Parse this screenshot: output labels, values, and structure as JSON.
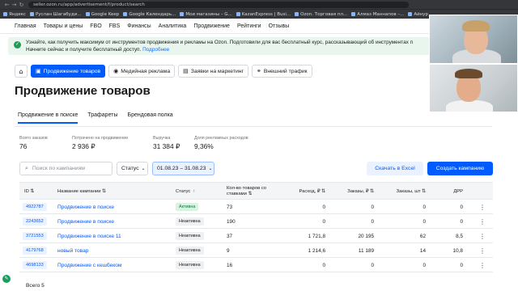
{
  "browser": {
    "url": "seller.ozon.ru/app/advertisement/f/product/search",
    "bookmarks": [
      "Яндекс",
      "Руслан Шагабуди...",
      "Google Keep",
      "Google Календарь...",
      "Мои магазины – G...",
      "KazanExpress | Busi...",
      "Ozon. Торговая пл...",
      "Алмаз Маннапов –...",
      "Айнур"
    ]
  },
  "nav": [
    "Главная",
    "Товары и цены",
    "FBO",
    "FBS",
    "Финансы",
    "Аналитика",
    "Продвижение",
    "Рейтинги",
    "Отзывы"
  ],
  "banner": {
    "text": "Узнайте, как получить максимум от инструментов продвижения и рекламы на Ozon. Подготовили для вас бесплатный курс, рассказывающий об инструментах п",
    "text2": "Начните сейчас и получите бесплатный доступ.",
    "link": "Подробнее"
  },
  "tools": [
    {
      "label": "Продвижение товаров",
      "icon": "megaphone-icon",
      "active": true
    },
    {
      "label": "Медийная реклама",
      "icon": "eye-icon",
      "active": false
    },
    {
      "label": "Заявки на маркетинг",
      "icon": "document-icon",
      "active": false
    },
    {
      "label": "Внешний трафик",
      "icon": "link-icon",
      "active": false
    }
  ],
  "page_title": "Продвижение товаров",
  "subtabs": [
    "Продвижение в поиске",
    "Трафареты",
    "Брендовая полка"
  ],
  "stats": [
    {
      "label": "Всего заказов",
      "value": "76"
    },
    {
      "label": "Потрачено на продвижение",
      "value": "2 936 ₽"
    },
    {
      "label": "Выручка",
      "value": "31 384 ₽"
    },
    {
      "label": "Доля рекламных расходов",
      "value": "9,36%"
    }
  ],
  "filters": {
    "search_placeholder": "Поиск по кампаниям",
    "status_label": "Статус",
    "date_range": "01.08.23 – 31.08.23",
    "excel_button": "Скачать в Excel",
    "create_button": "Создать кампанию"
  },
  "table": {
    "headers": {
      "id": "ID ⇅",
      "name": "Название кампании ⇅",
      "status": "Статус",
      "sort_arrow": "↑",
      "products": "Кол-во товаров со ставками ⇅",
      "spend": "Расход, ₽ ⇅",
      "orders_rub": "Заказы, ₽ ⇅",
      "orders_pcs": "Заказы, шт ⇅",
      "drr": "ДРР"
    },
    "rows": [
      {
        "id": "4922787",
        "name": "Продвижение в поиске",
        "status": "Активна",
        "active": true,
        "products": "73",
        "spend": "0",
        "orders_rub": "0",
        "orders_pcs": "0",
        "drr": "0"
      },
      {
        "id": "2243652",
        "name": "Продвижение в поиске",
        "status": "Неактивна",
        "active": false,
        "products": "190",
        "spend": "0",
        "orders_rub": "0",
        "orders_pcs": "0",
        "drr": "0"
      },
      {
        "id": "3721553",
        "name": "Продвижение в поиске 11",
        "status": "Неактивна",
        "active": false,
        "products": "37",
        "spend": "1 721,8",
        "orders_rub": "20 195",
        "orders_pcs": "62",
        "drr": "8,5"
      },
      {
        "id": "4179768",
        "name": "новый товар",
        "status": "Неактивна",
        "active": false,
        "products": "9",
        "spend": "1 214,6",
        "orders_rub": "11 189",
        "orders_pcs": "14",
        "drr": "10,8"
      },
      {
        "id": "4698133",
        "name": "Продвижение с кешбеком",
        "status": "Неактивна",
        "active": false,
        "products": "16",
        "spend": "0",
        "orders_rub": "0",
        "orders_pcs": "0",
        "drr": "0"
      }
    ],
    "total": "Всего 5"
  }
}
